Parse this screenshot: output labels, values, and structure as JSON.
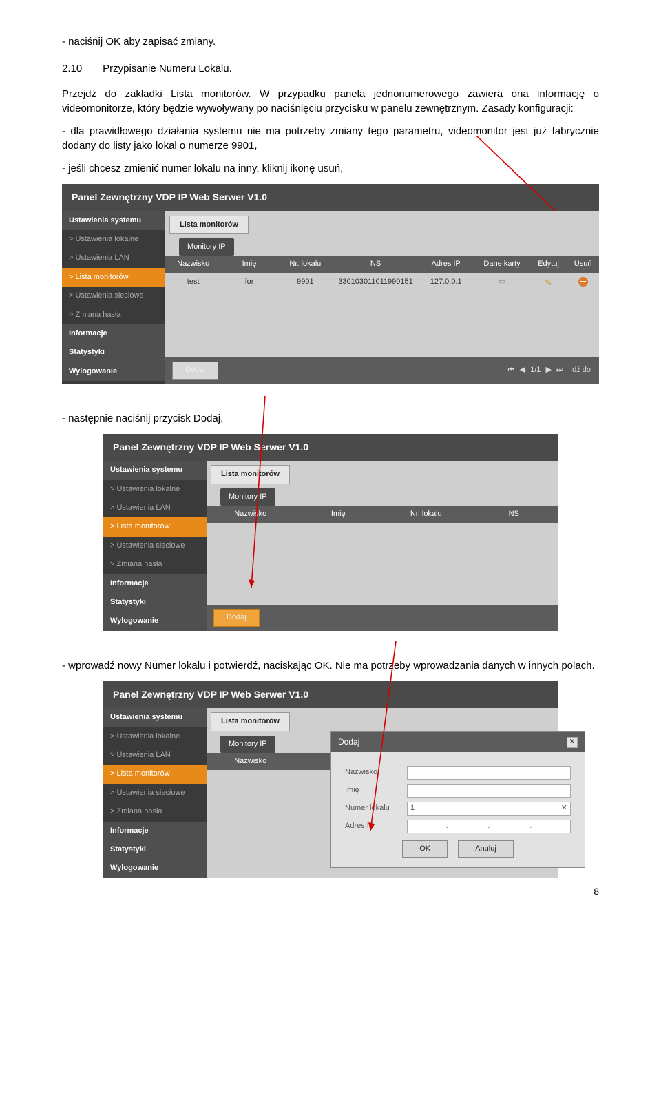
{
  "doc": {
    "line1": "- naciśnij OK aby zapisać zmiany.",
    "line2_num": "2.10",
    "line2_title": "Przypisanie Numeru Lokalu.",
    "para1": "Przejdź do zakładki Lista monitorów. W przypadku panela jednonumerowego zawiera ona informację o videomonitorze, który będzie wywoływany po naciśnięciu przycisku w panelu zewnętrznym. Zasady konfiguracji:",
    "bullet1": "- dla prawidłowego działania systemu nie ma potrzeby zmiany tego parametru, videomonitor jest już fabrycznie dodany do listy jako lokal o numerze 9901,",
    "bullet2": "- jeśli chcesz zmienić numer lokalu na inny, kliknij ikonę usuń,",
    "middle": "- następnie naciśnij przycisk Dodaj,",
    "para2": "- wprowadź nowy Numer lokalu i potwierdź, naciskając OK. Nie ma potrzeby wprowadzania danych w innych polach.",
    "pagenum": "8"
  },
  "panel": {
    "title": "Panel Zewnętrzny VDP IP Web Serwer V1.0",
    "sidebar": {
      "head": "Ustawienia systemu",
      "items": [
        "Ustawienia lokalne",
        "Ustawienia LAN",
        "Lista monitorów",
        "Ustawienia sieciowe",
        "Zmiana hasła"
      ],
      "bottom": [
        "Informacje",
        "Statystyki",
        "Wylogowanie"
      ]
    },
    "tab": "Lista monitorów",
    "chip": "Monitory IP",
    "dodaj": "Dodaj"
  },
  "table1": {
    "headers": [
      "Nazwisko",
      "Imię",
      "Nr. lokalu",
      "NS",
      "Adres IP",
      "Dane karty",
      "Edytuj",
      "Usuń"
    ],
    "row": [
      "test",
      "for",
      "9901",
      "330103011011990151",
      "127.0.0.1",
      "📄",
      "✎",
      ""
    ],
    "pager": "1/1",
    "goto": "Idź do"
  },
  "table2": {
    "headers": [
      "Nazwisko",
      "Imię",
      "Nr. lokalu",
      "NS"
    ]
  },
  "modal": {
    "title": "Dodaj",
    "labels": [
      "Nazwisko",
      "Imię",
      "Numer lokalu",
      "Adres IP"
    ],
    "numval": "1",
    "ok": "OK",
    "cancel": "Anuluj"
  }
}
